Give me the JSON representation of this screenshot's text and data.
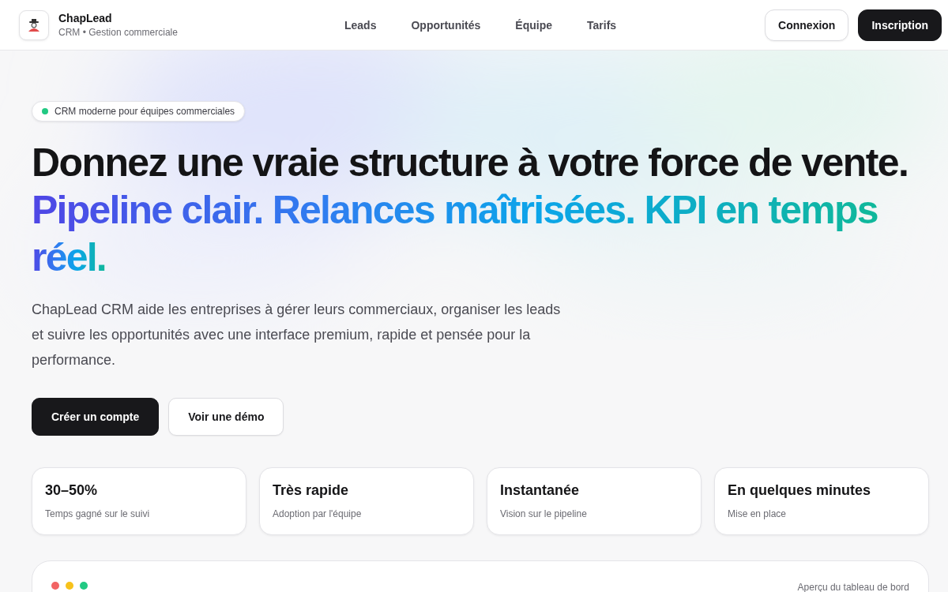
{
  "brand": {
    "name": "ChapLead",
    "tagline": "CRM • Gestion commerciale"
  },
  "nav": [
    {
      "label": "Leads"
    },
    {
      "label": "Opportunités"
    },
    {
      "label": "Équipe"
    },
    {
      "label": "Tarifs"
    }
  ],
  "auth_buttons": [
    {
      "label": "Connexion",
      "kind": "outline"
    },
    {
      "label": "Inscription",
      "kind": "solid"
    }
  ],
  "hero": {
    "badge": {
      "label": "CRM moderne pour équipes commerciales",
      "color": "#22c983"
    },
    "title": "Donnez une vraie structure à votre force de vente.",
    "subtitle": "Pipeline clair. Relances maîtrisées. KPI en temps réel.",
    "description": "ChapLead CRM aide les entreprises à gérer leurs commerciaux, organiser les leads et suivre les opportunités avec une interface premium, rapide et pensée pour la performance.",
    "buttons": [
      {
        "label": "Créer un compte",
        "kind": "solid"
      },
      {
        "label": "Voir une démo",
        "kind": "outline"
      }
    ]
  },
  "stats": [
    {
      "value": "30–50%",
      "label": "Temps gagné sur le suivi"
    },
    {
      "value": "Très rapide",
      "label": "Adoption par l'équipe"
    },
    {
      "value": "Instantanée",
      "label": "Vision sur le pipeline"
    },
    {
      "value": "En quelques minutes",
      "label": "Mise en place"
    }
  ],
  "preview": {
    "dots": [
      {
        "color": "#f26464"
      },
      {
        "color": "#f7c21b"
      },
      {
        "color": "#22c983"
      }
    ],
    "caption": "Aperçu du tableau de bord"
  }
}
